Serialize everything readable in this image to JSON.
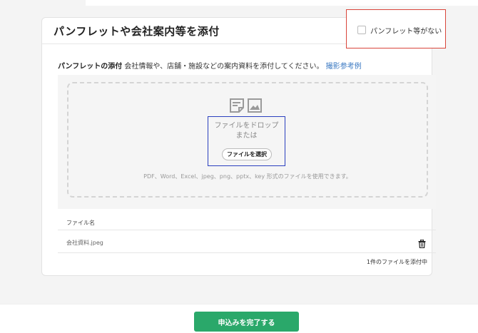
{
  "card": {
    "title": "パンフレットや会社案内等を添付",
    "no_pamphlet_label": "パンフレット等がない"
  },
  "description": {
    "bold": "パンフレットの添付",
    "text": " 会社情報や、店舗・施設などの案内資料を添付してください。 ",
    "link": "撮影参考例"
  },
  "dropzone": {
    "icons": [
      "document-icon",
      "image-icon"
    ],
    "line1": "ファイルをドロップ",
    "line2": "または",
    "select_button": "ファイルを選択",
    "formats": "PDF、Word、Excel、jpeg、png、pptx、key 形式のファイルを使用できます。"
  },
  "files": {
    "header": "ファイル名",
    "rows": [
      {
        "name": "会社資料.jpeg"
      }
    ],
    "count_text": "1件のファイルを添付中"
  },
  "footer": {
    "submit_label": "申込みを完了する",
    "button_color": "#2aa86a"
  }
}
